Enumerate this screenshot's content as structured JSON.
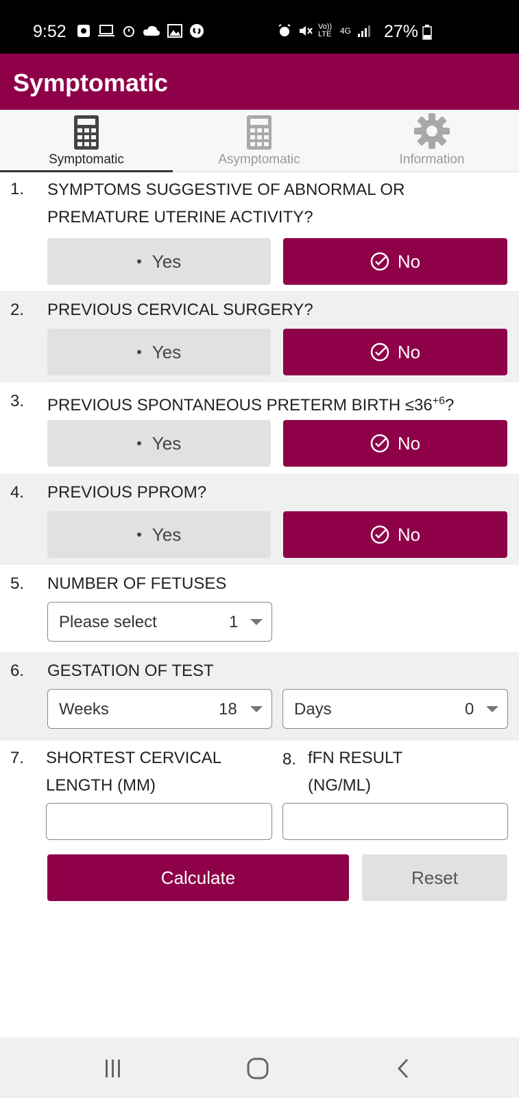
{
  "status_bar": {
    "time": "9:52",
    "network": "Vo)) LTE",
    "net_type": "4G",
    "battery": "27%"
  },
  "app": {
    "title": "Symptomatic"
  },
  "tabs": [
    {
      "label": "Symptomatic",
      "icon": "calculator-icon",
      "active": true
    },
    {
      "label": "Asymptomatic",
      "icon": "calculator-icon",
      "active": false
    },
    {
      "label": "Information",
      "icon": "gear-icon",
      "active": false
    }
  ],
  "questions": [
    {
      "num": "1.",
      "text": "SYMPTOMS SUGGESTIVE OF ABNORMAL OR PREMATURE UTERINE ACTIVITY?",
      "yes": "Yes",
      "no": "No",
      "selected": "No"
    },
    {
      "num": "2.",
      "text": "PREVIOUS CERVICAL SURGERY?",
      "yes": "Yes",
      "no": "No",
      "selected": "No"
    },
    {
      "num": "3.",
      "text_prefix": "PREVIOUS SPONTANEOUS PRETERM BIRTH ≤36",
      "text_sup": "+6",
      "text_suffix": "?",
      "yes": "Yes",
      "no": "No",
      "selected": "No"
    },
    {
      "num": "4.",
      "text": "PREVIOUS PPROM?",
      "yes": "Yes",
      "no": "No",
      "selected": "No"
    }
  ],
  "fetuses": {
    "num": "5.",
    "label": "NUMBER OF FETUSES",
    "placeholder": "Please select",
    "value": "1"
  },
  "gestation": {
    "num": "6.",
    "label": "GESTATION OF TEST",
    "weeks_label": "Weeks",
    "weeks_value": "18",
    "days_label": "Days",
    "days_value": "0"
  },
  "cervical_length": {
    "num": "7.",
    "label_line1": "SHORTEST CERVICAL",
    "label_line2": "LENGTH (MM)",
    "value": ""
  },
  "ffn_result": {
    "num": "8.",
    "label_line1": "fFN RESULT",
    "label_line2": "(NG/ML)",
    "value": ""
  },
  "actions": {
    "calculate": "Calculate",
    "reset": "Reset"
  },
  "colors": {
    "brand": "#8e0048",
    "button_gray": "#e1e1e1",
    "shaded_row": "#f0f0f0"
  }
}
